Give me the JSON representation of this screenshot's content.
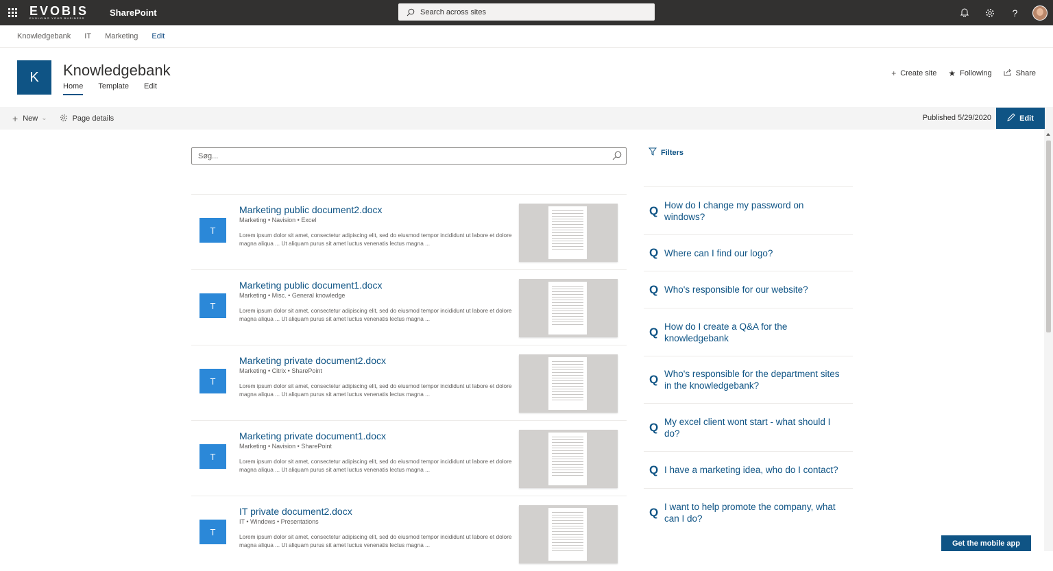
{
  "suite": {
    "brand": "EVOBIS",
    "tagline": "EVOLVING YOUR BUSINESS",
    "app_name": "SharePoint",
    "search_placeholder": "Search across sites"
  },
  "hub_nav": [
    "Knowledgebank",
    "IT",
    "Marketing",
    "Edit"
  ],
  "site": {
    "logo_letter": "K",
    "title": "Knowledgebank",
    "nav": [
      "Home",
      "Template",
      "Edit"
    ],
    "actions": {
      "create_site": "Create site",
      "following": "Following",
      "share": "Share"
    }
  },
  "command_bar": {
    "new_label": "New",
    "page_details_label": "Page details",
    "published": "Published 5/29/2020",
    "edit_label": "Edit"
  },
  "search": {
    "placeholder": "Søg..."
  },
  "filters_label": "Filters",
  "results": [
    {
      "tile": "T",
      "title": "Marketing public document2.docx",
      "meta": "Marketing  •  Navision  •  Excel",
      "desc": "Lorem ipsum dolor sit amet, consectetur adipiscing elit, sed do eiusmod tempor incididunt ut labore et dolore magna aliqua ... Ut aliquam purus sit amet luctus venenatis lectus magna ..."
    },
    {
      "tile": "T",
      "title": "Marketing public document1.docx",
      "meta": "Marketing  •  Misc.  •  General knowledge",
      "desc": "Lorem ipsum dolor sit amet, consectetur adipiscing elit, sed do eiusmod tempor incididunt ut labore et dolore magna aliqua ... Ut aliquam purus sit amet luctus venenatis lectus magna ..."
    },
    {
      "tile": "T",
      "title": "Marketing private document2.docx",
      "meta": "Marketing  •  Citrix  •  SharePoint",
      "desc": "Lorem ipsum dolor sit amet, consectetur adipiscing elit, sed do eiusmod tempor incididunt ut labore et dolore magna aliqua ... Ut aliquam purus sit amet luctus venenatis lectus magna ..."
    },
    {
      "tile": "T",
      "title": "Marketing private document1.docx",
      "meta": "Marketing  •  Navision  •  SharePoint",
      "desc": "Lorem ipsum dolor sit amet, consectetur adipiscing elit, sed do eiusmod tempor incididunt ut labore et dolore magna aliqua ... Ut aliquam purus sit amet luctus venenatis lectus magna ..."
    },
    {
      "tile": "T",
      "title": "IT private document2.docx",
      "meta": "IT  •  Windows  •  Presentations",
      "desc": "Lorem ipsum dolor sit amet, consectetur adipiscing elit, sed do eiusmod tempor incididunt ut labore et dolore magna aliqua ... Ut aliquam purus sit amet luctus venenatis lectus magna ..."
    }
  ],
  "faq": [
    {
      "q": "Q",
      "text": "How do I change my password on windows?"
    },
    {
      "q": "Q",
      "text": "Where can I find our logo?"
    },
    {
      "q": "Q",
      "text": "Who's responsible for our website?"
    },
    {
      "q": "Q",
      "text": "How do I create a Q&A for the knowledgebank"
    },
    {
      "q": "Q",
      "text": "Who's responsible for the department sites in the knowledgebank?"
    },
    {
      "q": "Q",
      "text": "My excel client wont start - what should I do?"
    },
    {
      "q": "Q",
      "text": "I have a marketing idea, who do I contact?"
    },
    {
      "q": "Q",
      "text": "I want to help promote the company, what can I do?"
    }
  ],
  "mobile_app_label": "Get the mobile app",
  "icons": {
    "waffle": "app-launcher-icon",
    "bell": "notification-bell-icon",
    "gear": "settings-gear-icon",
    "help": "help-icon"
  },
  "colors": {
    "accent": "#0f5485",
    "tile": "#2b88d8",
    "suitebar": "#323130"
  }
}
